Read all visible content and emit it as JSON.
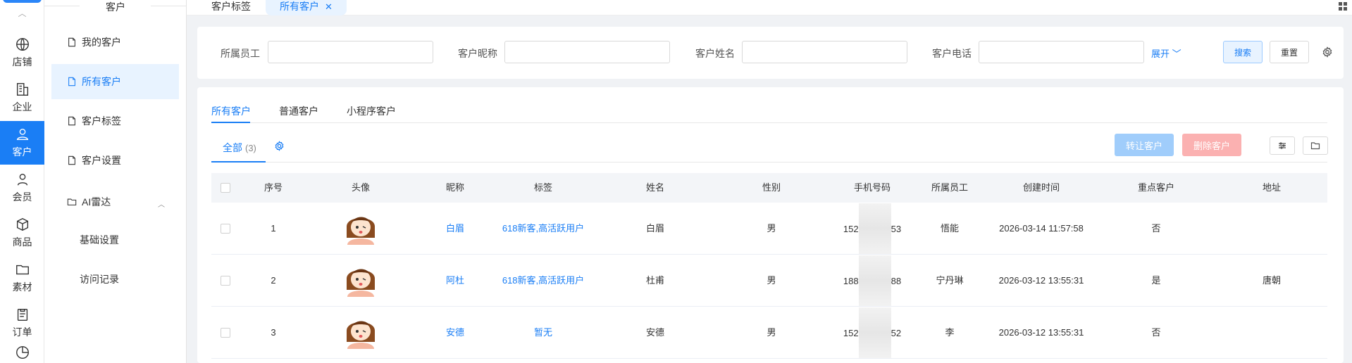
{
  "rail": {
    "items": [
      {
        "label": "店铺",
        "icon": "globe-icon"
      },
      {
        "label": "企业",
        "icon": "building-icon"
      },
      {
        "label": "客户",
        "icon": "user-icon",
        "active": true
      },
      {
        "label": "会员",
        "icon": "member-icon"
      },
      {
        "label": "商品",
        "icon": "box-icon"
      },
      {
        "label": "素材",
        "icon": "folder-icon"
      },
      {
        "label": "订单",
        "icon": "clipboard-icon"
      }
    ]
  },
  "menu": {
    "title": "客户",
    "items": [
      {
        "label": "我的客户"
      },
      {
        "label": "所有客户",
        "active": true
      },
      {
        "label": "客户标签"
      },
      {
        "label": "客户设置"
      },
      {
        "label": "AI雷达"
      }
    ],
    "sub_items": [
      {
        "label": "基础设置"
      },
      {
        "label": "访问记录"
      }
    ]
  },
  "tabs": [
    {
      "label": "客户标签"
    },
    {
      "label": "所有客户",
      "active": true
    }
  ],
  "filter": {
    "employee_label": "所属员工",
    "nickname_label": "客户昵称",
    "name_label": "客户姓名",
    "phone_label": "客户电话",
    "employee_value": "",
    "nickname_value": "",
    "name_value": "",
    "phone_value": "",
    "expand_label": "展开",
    "search_label": "搜索",
    "reset_label": "重置"
  },
  "content_tabs": [
    {
      "label": "所有客户",
      "active": true
    },
    {
      "label": "普通客户"
    },
    {
      "label": "小程序客户"
    }
  ],
  "sub_tab": {
    "label": "全部",
    "count": "(3)"
  },
  "actions": {
    "transfer_label": "转让客户",
    "delete_label": "删除客户"
  },
  "table": {
    "columns": [
      "序号",
      "头像",
      "昵称",
      "标签",
      "姓名",
      "性别",
      "手机号码",
      "所属员工",
      "创建时间",
      "重点客户",
      "地址"
    ],
    "rows": [
      {
        "index": "1",
        "nickname": "白眉",
        "tags": "618新客,高活跃用户",
        "name": "白眉",
        "gender": "男",
        "phone_prefix": "152",
        "phone_suffix": "53",
        "employee": "悟能",
        "created": "2026-03-14 11:57:58",
        "key_customer": "否",
        "address": ""
      },
      {
        "index": "2",
        "nickname": "阿杜",
        "tags": "618新客,高活跃用户",
        "name": "杜甫",
        "gender": "男",
        "phone_prefix": "188",
        "phone_suffix": "88",
        "employee": "宁丹琳",
        "created": "2026-03-12 13:55:31",
        "key_customer": "是",
        "address": "唐朝"
      },
      {
        "index": "3",
        "nickname": "安德",
        "tags": "暂无",
        "name": "安德",
        "gender": "男",
        "phone_prefix": "152",
        "phone_suffix": "52",
        "employee": "李",
        "created": "2026-03-12 13:55:31",
        "key_customer": "否",
        "address": ""
      }
    ]
  },
  "colors": {
    "primary": "#1a7ef5",
    "danger_disabled": "#fbb1b1",
    "primary_disabled": "#a0cdfb"
  }
}
